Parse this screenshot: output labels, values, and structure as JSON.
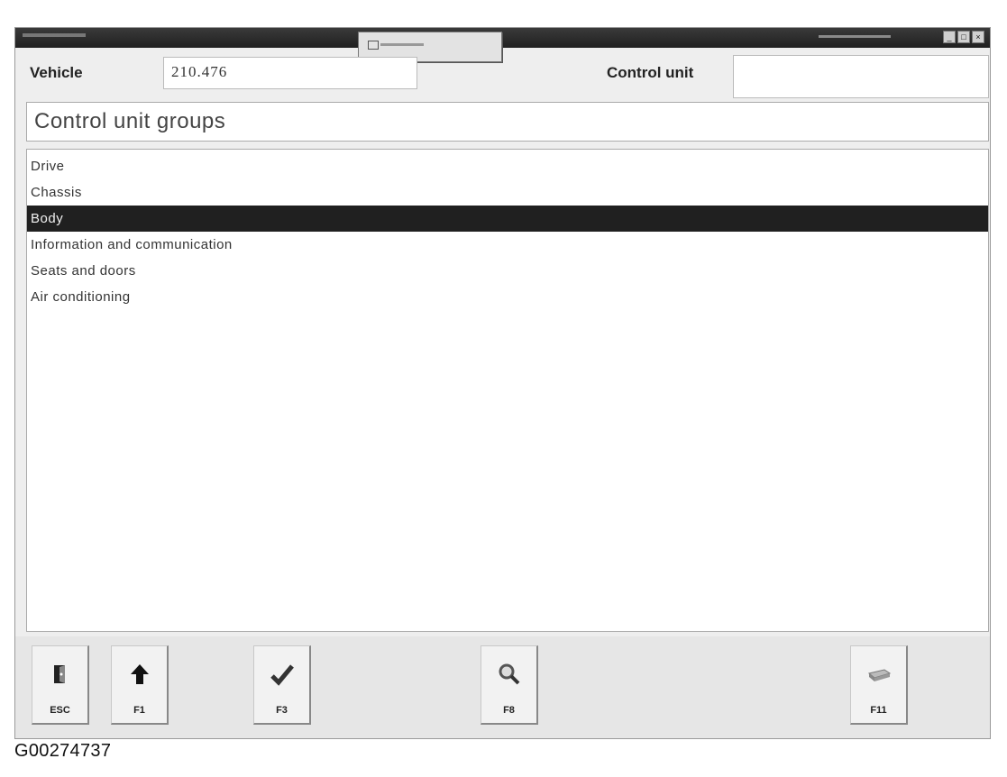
{
  "vehicle": {
    "label": "Vehicle",
    "value": "210.476"
  },
  "control_unit": {
    "label": "Control unit",
    "value": ""
  },
  "groups": {
    "header": "Control unit groups",
    "items": [
      "Drive",
      "Chassis",
      "Body",
      "Information and communication",
      "Seats and doors",
      "Air conditioning"
    ],
    "selected_index": 2
  },
  "toolbar": {
    "buttons": [
      {
        "key": "ESC",
        "icon": "exit-door-icon"
      },
      {
        "key": "F1",
        "icon": "arrow-up-icon"
      },
      {
        "key": "F3",
        "icon": "checkmark-icon"
      },
      {
        "key": "F8",
        "icon": "magnifier-icon"
      },
      {
        "key": "F11",
        "icon": "printer-icon"
      }
    ]
  },
  "caption": "G00274737"
}
